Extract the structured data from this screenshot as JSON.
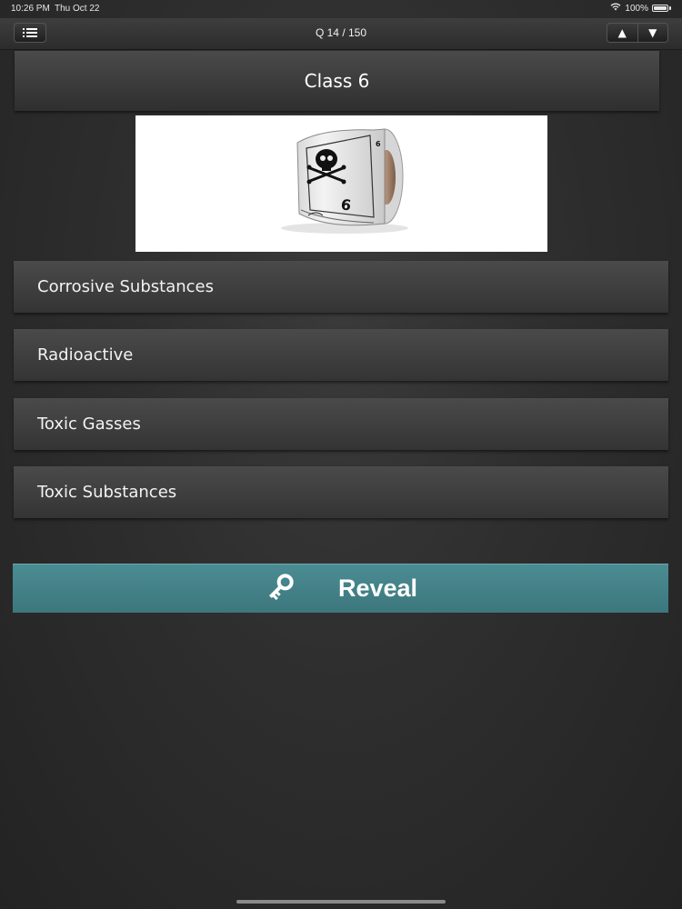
{
  "status_bar": {
    "time": "10:26 PM",
    "date": "Thu Oct 22",
    "battery": "100%",
    "wifi_icon": "wifi-icon",
    "battery_icon": "battery-icon"
  },
  "nav": {
    "menu_icon": "list-icon",
    "progress": "Q 14 / 150",
    "up_label": "▲",
    "down_label": "▼"
  },
  "question": {
    "title": "Class 6",
    "image": {
      "description_icon": "poison-label-roll-image",
      "number_on_label": "6"
    }
  },
  "answers": [
    {
      "label": "Corrosive Substances"
    },
    {
      "label": "Radioactive"
    },
    {
      "label": "Toxic Gasses"
    },
    {
      "label": "Toxic Substances"
    }
  ],
  "reveal": {
    "label": "Reveal",
    "icon": "key-icon",
    "color": "#418189"
  }
}
